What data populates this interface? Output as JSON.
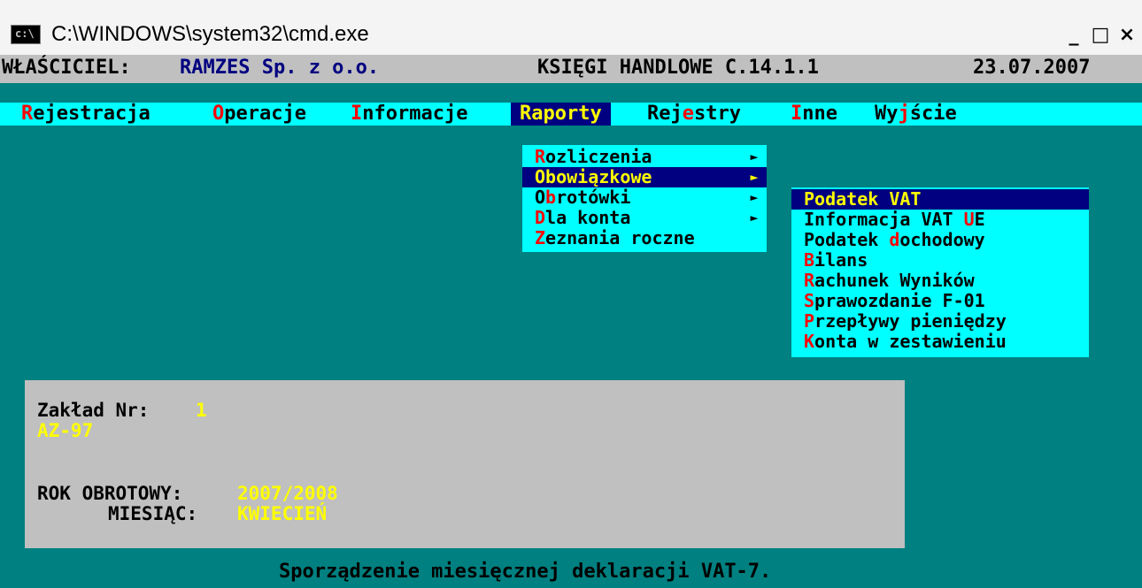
{
  "window": {
    "title": "C:\\WINDOWS\\system32\\cmd.exe",
    "icon": "console-icon",
    "icon_text": "c:\\",
    "minimize": "_",
    "maximize": "□",
    "close": "×"
  },
  "status": {
    "owner_label": "WŁAŚCICIEL:",
    "owner_value": "RAMZES Sp. z o.o.",
    "app_name": "KSIĘGI HANDLOWE C.14.1.1",
    "date": "23.07.2007"
  },
  "menu": [
    {
      "hot": "R",
      "rest": "ejestracja"
    },
    {
      "hot": "O",
      "rest": "peracje"
    },
    {
      "hot": "I",
      "rest": "nformacje"
    },
    {
      "hot": "R",
      "rest": "aporty"
    },
    {
      "pre": "Rej",
      "hot": "e",
      "rest": "stry"
    },
    {
      "hot": "I",
      "rest": "nne"
    },
    {
      "pre": "Wy",
      "hot": "j",
      "rest": "ście"
    }
  ],
  "raporty_menu": [
    {
      "hot": "R",
      "rest": "ozliczenia",
      "arrow": "►"
    },
    {
      "hot": "O",
      "rest": "bowiązkowe",
      "arrow": "►"
    },
    {
      "pre": "O",
      "hot": "b",
      "rest": "rotówki",
      "arrow": "►"
    },
    {
      "hot": "D",
      "rest": "la konta",
      "arrow": "►"
    },
    {
      "hot": "Z",
      "rest": "eznania roczne"
    }
  ],
  "obowiazkowe_menu": [
    {
      "pre": "",
      "hot": "",
      "rest": "Podatek VAT"
    },
    {
      "pre": "Informacja VAT ",
      "hot": "U",
      "rest": "E"
    },
    {
      "pre": "Podatek ",
      "hot": "d",
      "rest": "ochodowy"
    },
    {
      "pre": "",
      "hot": "B",
      "rest": "ilans"
    },
    {
      "pre": "",
      "hot": "R",
      "rest": "achunek Wyników"
    },
    {
      "pre": "",
      "hot": "S",
      "rest": "prawozdanie F-01"
    },
    {
      "pre": "",
      "hot": "P",
      "rest": "rzepływy pieniędzy"
    },
    {
      "pre": "",
      "hot": "K",
      "rest": "onta w zestawieniu"
    }
  ],
  "info": {
    "zaklad_label": "Zakład Nr:",
    "zaklad_value": "1",
    "zaklad_name": "AZ-97",
    "rok_label": "ROK OBROTOWY:",
    "rok_value": "2007/2008",
    "miesiac_label": "MIESIĄC:",
    "miesiac_value": "KWIECIEŃ"
  },
  "help": "Sporządzenie miesięcznej deklaracji VAT-7.",
  "colors": {
    "background": "#008080",
    "menubar": "#00ffff",
    "highlight": "#000080",
    "hotkey": "#ff0000",
    "selected_text": "#ffff00",
    "panel": "#c0c0c0"
  }
}
